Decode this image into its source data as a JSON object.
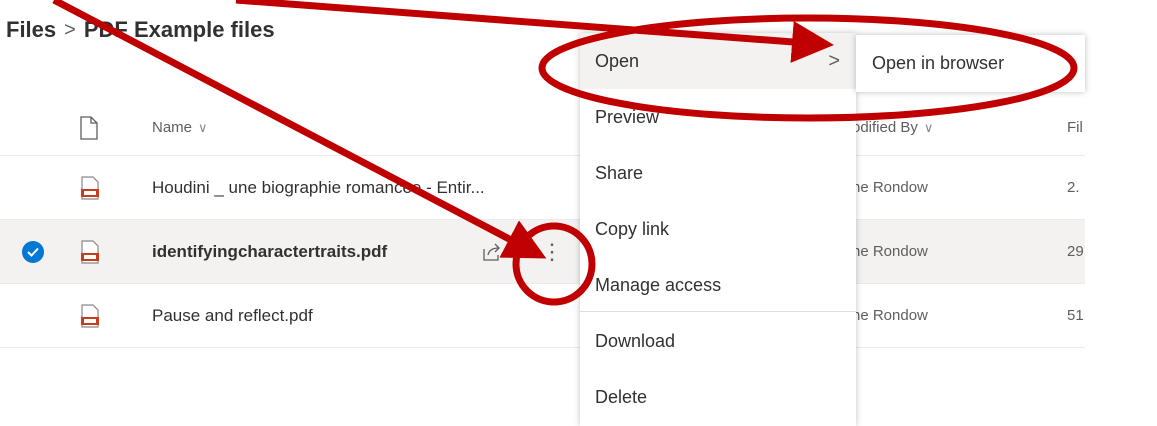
{
  "breadcrumb": {
    "root": "Files",
    "separator": ">",
    "current": "PDF Example files"
  },
  "columns": {
    "name": "Name",
    "modified_by": "odified By",
    "file_size": "Fil"
  },
  "rows": [
    {
      "name": "Houdini _ une biographie romancee - Entir...",
      "modified_by": "ne Rondow",
      "size": "2.",
      "selected": false
    },
    {
      "name": "identifyingcharactertraits.pdf",
      "modified_by": "ne Rondow",
      "size": "29",
      "selected": true
    },
    {
      "name": "Pause and reflect.pdf",
      "modified_by": "ne Rondow",
      "size": "51",
      "selected": false
    }
  ],
  "context_menu": {
    "items": [
      "Open",
      "Preview",
      "Share",
      "Copy link",
      "Manage access",
      "Download",
      "Delete"
    ],
    "submenu_chevron": ">"
  },
  "submenu": {
    "items": [
      "Open in browser"
    ]
  },
  "colors": {
    "accent": "#0078d4",
    "annotation": "#c00000",
    "pdf_icon": "#c43e1c"
  }
}
